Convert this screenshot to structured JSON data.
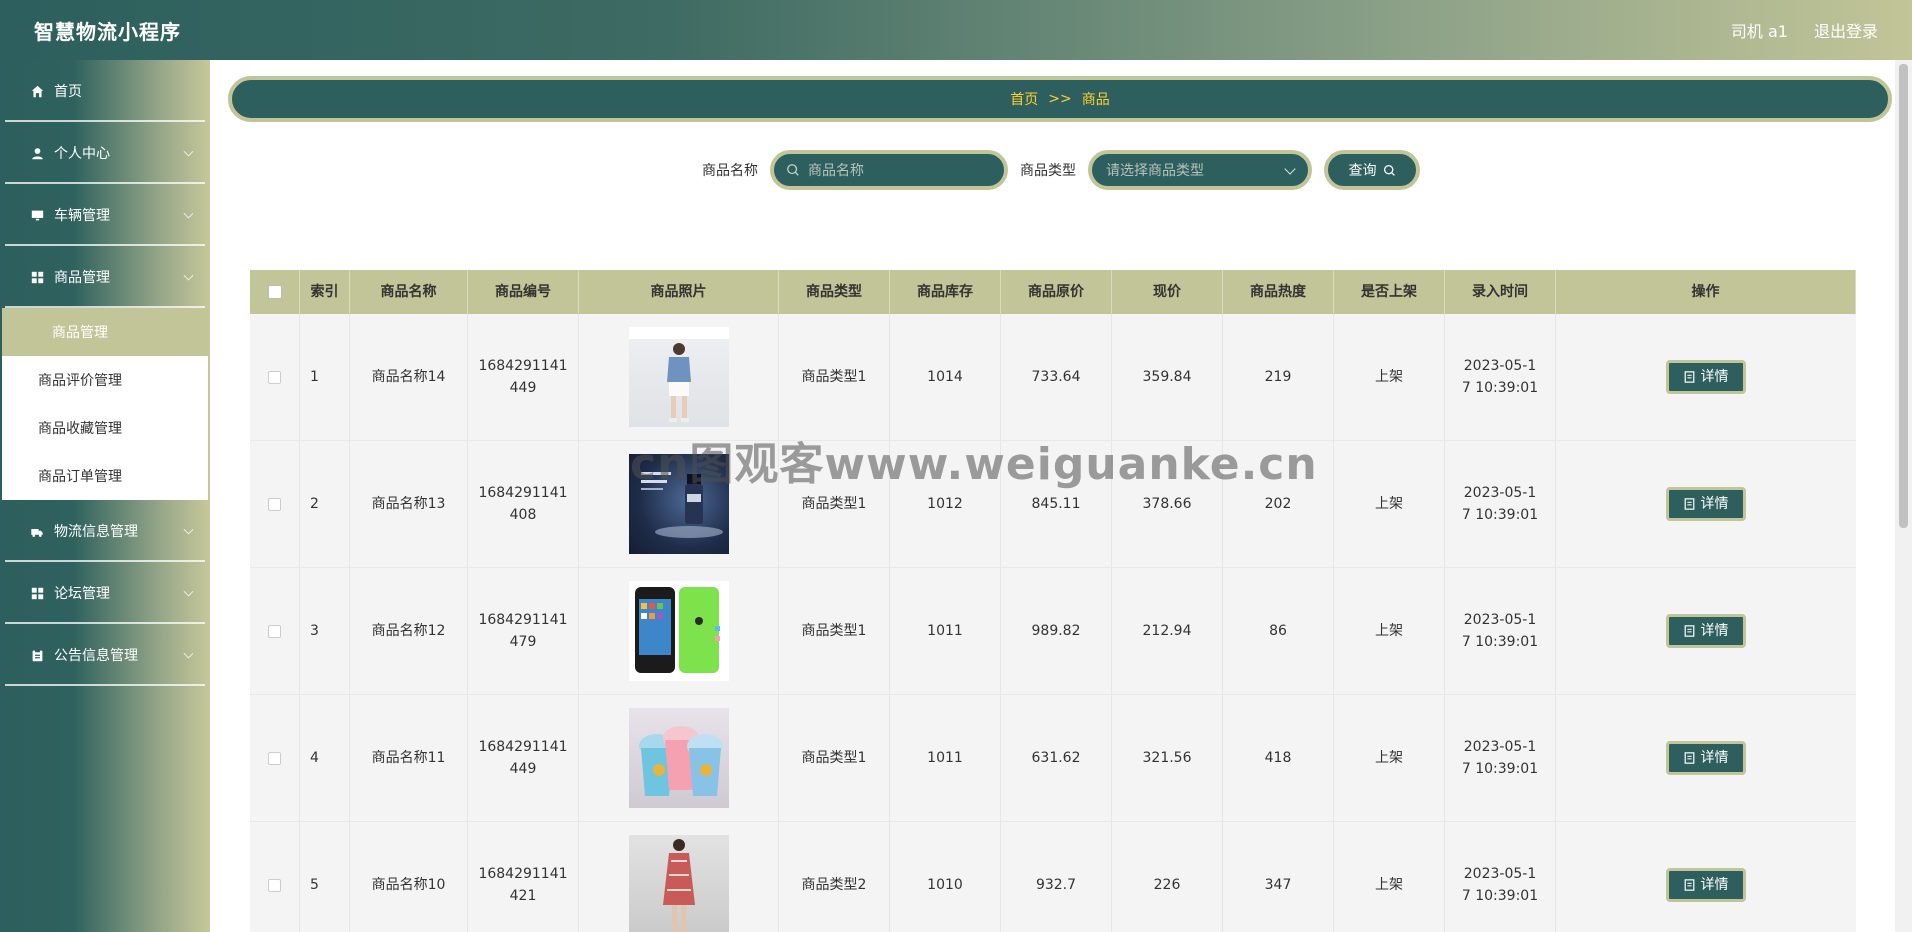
{
  "header": {
    "title": "智慧物流小程序",
    "user": "司机 a1",
    "logout": "退出登录"
  },
  "sidebar": {
    "items": [
      {
        "label": "首页",
        "icon": "home-icon"
      },
      {
        "label": "个人中心",
        "icon": "user-icon"
      },
      {
        "label": "车辆管理",
        "icon": "monitor-icon"
      },
      {
        "label": "商品管理",
        "icon": "grid-icon"
      },
      {
        "label": "物流信息管理",
        "icon": "truck-icon"
      },
      {
        "label": "论坛管理",
        "icon": "grid-icon"
      },
      {
        "label": "公告信息管理",
        "icon": "clipboard-icon"
      }
    ],
    "submenu": [
      "商品管理",
      "商品评价管理",
      "商品收藏管理",
      "商品订单管理"
    ]
  },
  "breadcrumb": {
    "home": "首页",
    "sep": ">>",
    "current": "商品"
  },
  "search": {
    "name_label": "商品名称",
    "name_placeholder": "商品名称",
    "type_label": "商品类型",
    "type_placeholder": "请选择商品类型",
    "query_label": "查询"
  },
  "table": {
    "headers": [
      "索引",
      "商品名称",
      "商品编号",
      "商品照片",
      "商品类型",
      "商品库存",
      "商品原价",
      "现价",
      "商品热度",
      "是否上架",
      "录入时间",
      "操作"
    ],
    "detail_label": "详情",
    "rows": [
      {
        "index": "1",
        "name": "商品名称14",
        "code": "1684291141449",
        "photo": "model-white-shorts-photo",
        "type": "商品类型1",
        "stock": "1014",
        "original": "733.64",
        "price": "359.84",
        "heat": "219",
        "listed": "上架",
        "time": "2023-05-17 10:39:01"
      },
      {
        "index": "2",
        "name": "商品名称13",
        "code": "1684291141408",
        "photo": "cosmetic-bottle-photo",
        "type": "商品类型1",
        "stock": "1012",
        "original": "845.11",
        "price": "378.66",
        "heat": "202",
        "listed": "上架",
        "time": "2023-05-17 10:39:01"
      },
      {
        "index": "3",
        "name": "商品名称12",
        "code": "1684291141479",
        "photo": "green-phone-photo",
        "type": "商品类型1",
        "stock": "1011",
        "original": "989.82",
        "price": "212.94",
        "heat": "86",
        "listed": "上架",
        "time": "2023-05-17 10:39:01"
      },
      {
        "index": "4",
        "name": "商品名称11",
        "code": "1684291141449",
        "photo": "colored-cups-photo",
        "type": "商品类型1",
        "stock": "1011",
        "original": "631.62",
        "price": "321.56",
        "heat": "418",
        "listed": "上架",
        "time": "2023-05-17 10:39:01"
      },
      {
        "index": "5",
        "name": "商品名称10",
        "code": "1684291141421",
        "photo": "model-red-dress-photo",
        "type": "商品类型2",
        "stock": "1010",
        "original": "932.7",
        "price": "226",
        "heat": "347",
        "listed": "上架",
        "time": "2023-05-17 10:39:01"
      }
    ]
  },
  "watermark": "cn图观客www.weiguanke.cn",
  "colors": {
    "primary": "#2c5f5d",
    "accent": "#c2c597",
    "breadcrumb_text": "#ffcf33"
  }
}
